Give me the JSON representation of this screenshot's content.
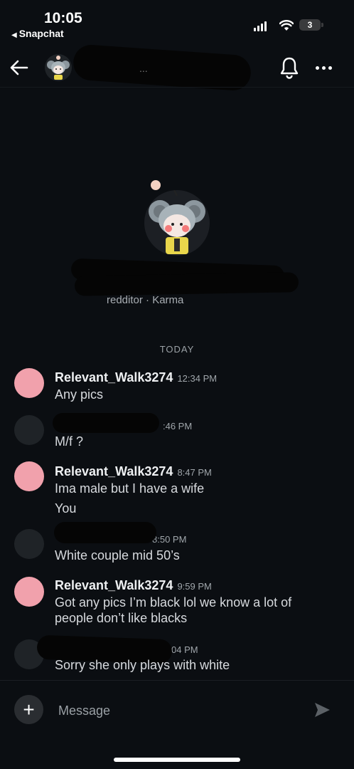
{
  "status_bar": {
    "time": "10:05",
    "back_app": "Snapchat",
    "battery": "3"
  },
  "header": {
    "title": "...",
    "bell_icon": "bell-icon",
    "more_icon": "more-horizontal-icon"
  },
  "profile": {
    "karma_line": "redditor ·    Karma"
  },
  "day_separator": "TODAY",
  "messages": [
    {
      "user": "Relevant_Walk3274",
      "time": "12:34 PM",
      "lines": [
        "Any pics"
      ]
    },
    {
      "user": "",
      "time": ":46 PM",
      "lines": [
        "M/f ?"
      ]
    },
    {
      "user": "Relevant_Walk3274",
      "time": "8:47 PM",
      "lines": [
        "Ima male but I have a wife",
        "You"
      ]
    },
    {
      "user": "",
      "time": "8:50 PM",
      "lines": [
        "White couple  mid 50’s"
      ]
    },
    {
      "user": "Relevant_Walk3274",
      "time": "9:59 PM",
      "lines": [
        "Got any pics I’m black lol we know a lot of",
        "people don’t like blacks"
      ]
    },
    {
      "user": "",
      "time": "04 PM",
      "lines": [
        "Sorry she only plays with white"
      ]
    }
  ],
  "composer": {
    "placeholder": "Message",
    "plus_label": "+"
  },
  "colors": {
    "background": "#0b0e12",
    "pink_avatar": "#f1a1ac"
  }
}
